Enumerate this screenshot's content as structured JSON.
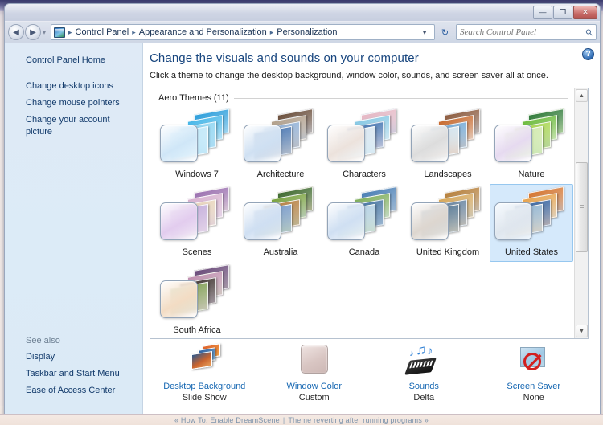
{
  "window": {
    "controls": {
      "minimize": "—",
      "maximize": "❐",
      "close": "✕"
    }
  },
  "navbar": {
    "back_icon": "◀",
    "forward_icon": "▶",
    "history_chevron": "▾",
    "address_icon": "control-panel-icon",
    "breadcrumbs": [
      "Control Panel",
      "Appearance and Personalization",
      "Personalization"
    ],
    "separator": "▸",
    "dropdown_icon": "▼",
    "refresh_icon": "↻",
    "search": {
      "placeholder": "Search Control Panel",
      "value": "",
      "icon": "search-icon"
    }
  },
  "sidebar": {
    "home_label": "Control Panel Home",
    "items": [
      {
        "label": "Change desktop icons"
      },
      {
        "label": "Change mouse pointers"
      },
      {
        "label": "Change your account picture"
      }
    ],
    "see_also": {
      "title": "See also",
      "items": [
        {
          "label": "Display"
        },
        {
          "label": "Taskbar and Start Menu"
        },
        {
          "label": "Ease of Access Center"
        }
      ]
    }
  },
  "main": {
    "help_icon": "?",
    "title": "Change the visuals and sounds on your computer",
    "subtitle": "Click a theme to change the desktop background, window color, sounds, and screen saver all at once.",
    "group_header": "Aero Themes (11)",
    "themes": [
      {
        "label": "Windows 7",
        "selected": false,
        "colors": [
          "#2a9ddb",
          "#45b6e8",
          "#8ad4f2",
          "#bde6f8"
        ],
        "tile": "#cfe6f7"
      },
      {
        "label": "Architecture",
        "selected": false,
        "colors": [
          "#6a4d39",
          "#b3a08a",
          "#8caed6",
          "#3f6fae"
        ],
        "tile": "#cfe0f2"
      },
      {
        "label": "Characters",
        "selected": false,
        "colors": [
          "#e8b8c4",
          "#86c8e4",
          "#3b6fae",
          "#d6e4ef"
        ],
        "tile": "#ece2dc"
      },
      {
        "label": "Landscapes",
        "selected": false,
        "colors": [
          "#8d5a3c",
          "#c86a2e",
          "#6ea8d8",
          "#cfe2ee"
        ],
        "tile": "#dcdcdc"
      },
      {
        "label": "Nature",
        "selected": false,
        "colors": [
          "#2f7a3a",
          "#6cbb3c",
          "#a8d64a",
          "#cfe8a8"
        ],
        "tile": "#e6daf0"
      },
      {
        "label": "Scenes",
        "selected": false,
        "colors": [
          "#9a6fb0",
          "#d8b2cf",
          "#e8d4b8",
          "#c0a8d8"
        ],
        "tile": "#e2ccee"
      },
      {
        "label": "Australia",
        "selected": false,
        "colors": [
          "#3d6a2f",
          "#7aa23c",
          "#b57a3a",
          "#6e93c6"
        ],
        "tile": "#cfdff2"
      },
      {
        "label": "Canada",
        "selected": false,
        "colors": [
          "#4a7fb5",
          "#7fae5a",
          "#3e6f9e",
          "#aecde4"
        ],
        "tile": "#cfdff2"
      },
      {
        "label": "United Kingdom",
        "selected": false,
        "colors": [
          "#b8803a",
          "#d8a85a",
          "#5f7f9e",
          "#4a6f8e"
        ],
        "tile": "#ddd6cf"
      },
      {
        "label": "United States",
        "selected": true,
        "colors": [
          "#d8762e",
          "#e8a24a",
          "#2f5f9e",
          "#8ab0cf"
        ],
        "tile": "#dfe6ee"
      },
      {
        "label": "South Africa",
        "selected": false,
        "colors": [
          "#6a4a7a",
          "#c08fb0",
          "#3a2f2a",
          "#7a9a4a"
        ],
        "tile": "#f3dcc4"
      }
    ],
    "options": [
      {
        "icon": "desktop-background-icon",
        "title": "Desktop Background",
        "value": "Slide Show"
      },
      {
        "icon": "window-color-icon",
        "title": "Window Color",
        "value": "Custom"
      },
      {
        "icon": "sounds-icon",
        "title": "Sounds",
        "value": "Delta"
      },
      {
        "icon": "screen-saver-icon",
        "title": "Screen Saver",
        "value": "None"
      }
    ]
  },
  "status_bar": {
    "prev_arrow": "«",
    "prev_link": "How To: Enable DreamScene",
    "separator": "|",
    "next_link": "Theme reverting after running programs",
    "next_arrow": "»"
  }
}
